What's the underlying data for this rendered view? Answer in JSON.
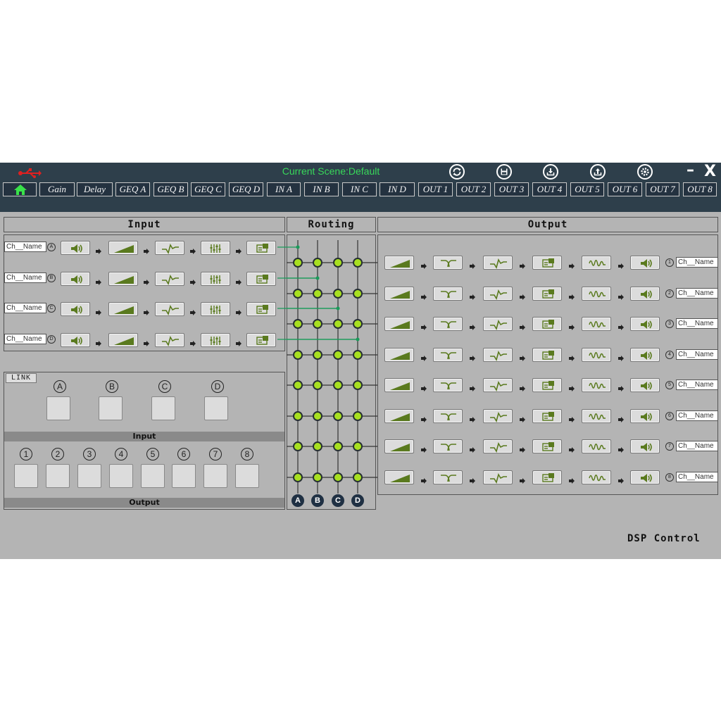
{
  "titlebar": {
    "scene_label": "Current Scene:Default",
    "icons": [
      "usb-icon",
      "refresh-icon",
      "save-icon",
      "download-icon",
      "upload-icon",
      "settings-icon"
    ],
    "minimize_label": "–",
    "close_label": "X",
    "usb_color": "#e02020"
  },
  "tabs": [
    {
      "id": "home",
      "label": ""
    },
    {
      "id": "gain",
      "label": "Gain"
    },
    {
      "id": "delay",
      "label": "Delay"
    },
    {
      "id": "geqa",
      "label": "GEQ A"
    },
    {
      "id": "geqb",
      "label": "GEQ B"
    },
    {
      "id": "geqc",
      "label": "GEQ C"
    },
    {
      "id": "geqd",
      "label": "GEQ D"
    },
    {
      "id": "ina",
      "label": "IN A"
    },
    {
      "id": "inb",
      "label": "IN B"
    },
    {
      "id": "inc",
      "label": "IN C"
    },
    {
      "id": "ind",
      "label": "IN D"
    },
    {
      "id": "out1",
      "label": "OUT 1"
    },
    {
      "id": "out2",
      "label": "OUT 2"
    },
    {
      "id": "out3",
      "label": "OUT 3"
    },
    {
      "id": "out4",
      "label": "OUT 4"
    },
    {
      "id": "out5",
      "label": "OUT 5"
    },
    {
      "id": "out6",
      "label": "OUT 6"
    },
    {
      "id": "out7",
      "label": "OUT 7"
    },
    {
      "id": "out8",
      "label": "OUT 8"
    }
  ],
  "input": {
    "title": "Input",
    "channels": [
      {
        "name": "Ch__Name",
        "letter": "A"
      },
      {
        "name": "Ch__Name",
        "letter": "B"
      },
      {
        "name": "Ch__Name",
        "letter": "C"
      },
      {
        "name": "Ch__Name",
        "letter": "D"
      }
    ]
  },
  "routing": {
    "title": "Routing",
    "columns": [
      "A",
      "B",
      "C",
      "D"
    ]
  },
  "output": {
    "title": "Output",
    "channels": [
      {
        "name": "Ch__Name",
        "number": "1"
      },
      {
        "name": "Ch__Name",
        "number": "2"
      },
      {
        "name": "Ch__Name",
        "number": "3"
      },
      {
        "name": "Ch__Name",
        "number": "4"
      },
      {
        "name": "Ch__Name",
        "number": "5"
      },
      {
        "name": "Ch__Name",
        "number": "6"
      },
      {
        "name": "Ch__Name",
        "number": "7"
      },
      {
        "name": "Ch__Name",
        "number": "8"
      }
    ]
  },
  "link": {
    "label": "LINK",
    "input_letters": [
      "A",
      "B",
      "C",
      "D"
    ],
    "input_bar": "Input",
    "output_numbers": [
      "1",
      "2",
      "3",
      "4",
      "5",
      "6",
      "7",
      "8"
    ],
    "output_bar": "Output"
  },
  "footer": {
    "brand": "DSP Control"
  },
  "colors": {
    "titlebar": "#2e3f4b",
    "panel": "#b4b4b4",
    "accent_green": "#38d85a",
    "node_green": "#a8e020",
    "route_line": "#1a9a5a"
  }
}
